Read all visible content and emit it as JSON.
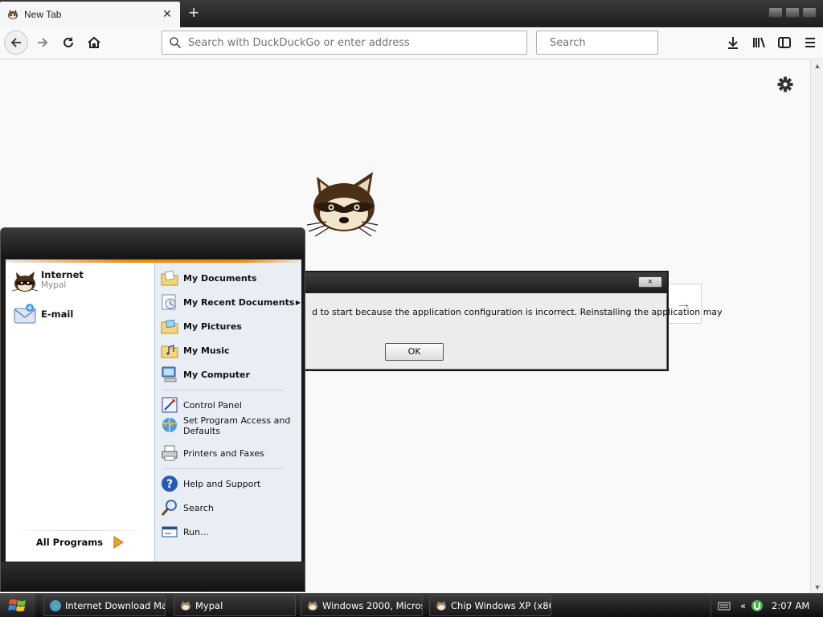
{
  "browser": {
    "tab_title": "New Tab",
    "tab_close": "×",
    "new_tab": "+",
    "url_placeholder": "Search with DuckDuckGo or enter address",
    "search_placeholder": "Search"
  },
  "page": {
    "go_arrow": "→"
  },
  "dialog": {
    "message": "d to start because the application configuration is incorrect. Reinstalling the application may",
    "ok_label": "OK",
    "close_label": "×"
  },
  "start_menu": {
    "pinned": [
      {
        "title": "Internet",
        "subtitle": "Mypal"
      },
      {
        "title": "E-mail",
        "subtitle": ""
      }
    ],
    "all_programs": "All Programs",
    "places": [
      "My Documents",
      "My Recent Documents",
      "My Pictures",
      "My Music",
      "My Computer"
    ],
    "settings": [
      "Control Panel",
      "Set Program Access and Defaults",
      "Printers and Faxes"
    ],
    "tools": [
      "Help and Support",
      "Search",
      "Run..."
    ]
  },
  "taskbar": {
    "buttons": [
      "Internet Download Ma...",
      "Mypal",
      "Windows 2000, Micros...",
      "Chip Windows XP (x86..."
    ],
    "tray_chevron": "«",
    "clock": "2:07 AM"
  },
  "colors": {
    "accent_orange": "#f28a0c",
    "taskbar_dark": "#1a1a1a"
  }
}
